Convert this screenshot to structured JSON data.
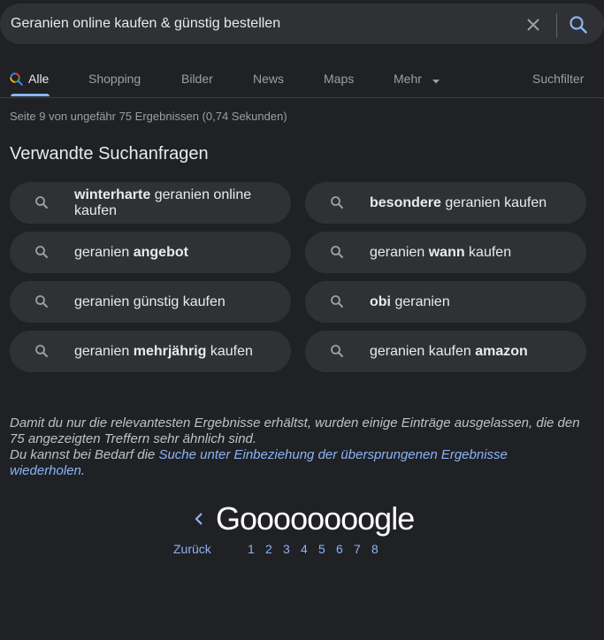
{
  "search": {
    "query": "Geranien online kaufen & günstig bestellen"
  },
  "tabs": [
    {
      "label": "Alle",
      "active": true
    },
    {
      "label": "Shopping"
    },
    {
      "label": "Bilder"
    },
    {
      "label": "News"
    },
    {
      "label": "Maps"
    },
    {
      "label": "Mehr"
    },
    {
      "label": "Suchfilter"
    }
  ],
  "stats": "Seite 9 von ungefähr 75 Ergebnissen (0,74 Sekunden)",
  "related": {
    "title": "Verwandte Suchanfragen",
    "items": [
      {
        "parts": [
          {
            "t": "winterharte",
            "b": true
          },
          {
            "t": " geranien online kaufen",
            "b": false
          }
        ]
      },
      {
        "parts": [
          {
            "t": "besondere",
            "b": true
          },
          {
            "t": " geranien kaufen",
            "b": false
          }
        ]
      },
      {
        "parts": [
          {
            "t": "geranien ",
            "b": false
          },
          {
            "t": "angebot",
            "b": true
          }
        ]
      },
      {
        "parts": [
          {
            "t": "geranien ",
            "b": false
          },
          {
            "t": "wann",
            "b": true
          },
          {
            "t": " kaufen",
            "b": false
          }
        ]
      },
      {
        "parts": [
          {
            "t": "geranien günstig kaufen",
            "b": false
          }
        ]
      },
      {
        "parts": [
          {
            "t": "obi",
            "b": true
          },
          {
            "t": " geranien",
            "b": false
          }
        ]
      },
      {
        "parts": [
          {
            "t": "geranien ",
            "b": false
          },
          {
            "t": "mehrjährig",
            "b": true
          },
          {
            "t": " kaufen",
            "b": false
          }
        ]
      },
      {
        "parts": [
          {
            "t": "geranien kaufen ",
            "b": false
          },
          {
            "t": "amazon",
            "b": true
          }
        ]
      }
    ]
  },
  "notice": {
    "line1": "Damit du nur die relevantesten Ergebnisse erhältst, wurden einige Einträge ausgelassen, die den 75 angezeigten Treffern sehr ähnlich sind.",
    "line2_prefix": "Du kannst bei Bedarf die ",
    "link": "Suche unter Einbeziehung der übersprungenen Ergebnisse wiederholen",
    "line2_suffix": "."
  },
  "pagination": {
    "logo": "Goooooooogle",
    "back": "Zurück",
    "pages": [
      "1",
      "2",
      "3",
      "4",
      "5",
      "6",
      "7",
      "8"
    ]
  },
  "colors": {
    "background": "#202124",
    "chip": "#303134",
    "link": "#8ab4f8",
    "text": "#e8eaed"
  }
}
